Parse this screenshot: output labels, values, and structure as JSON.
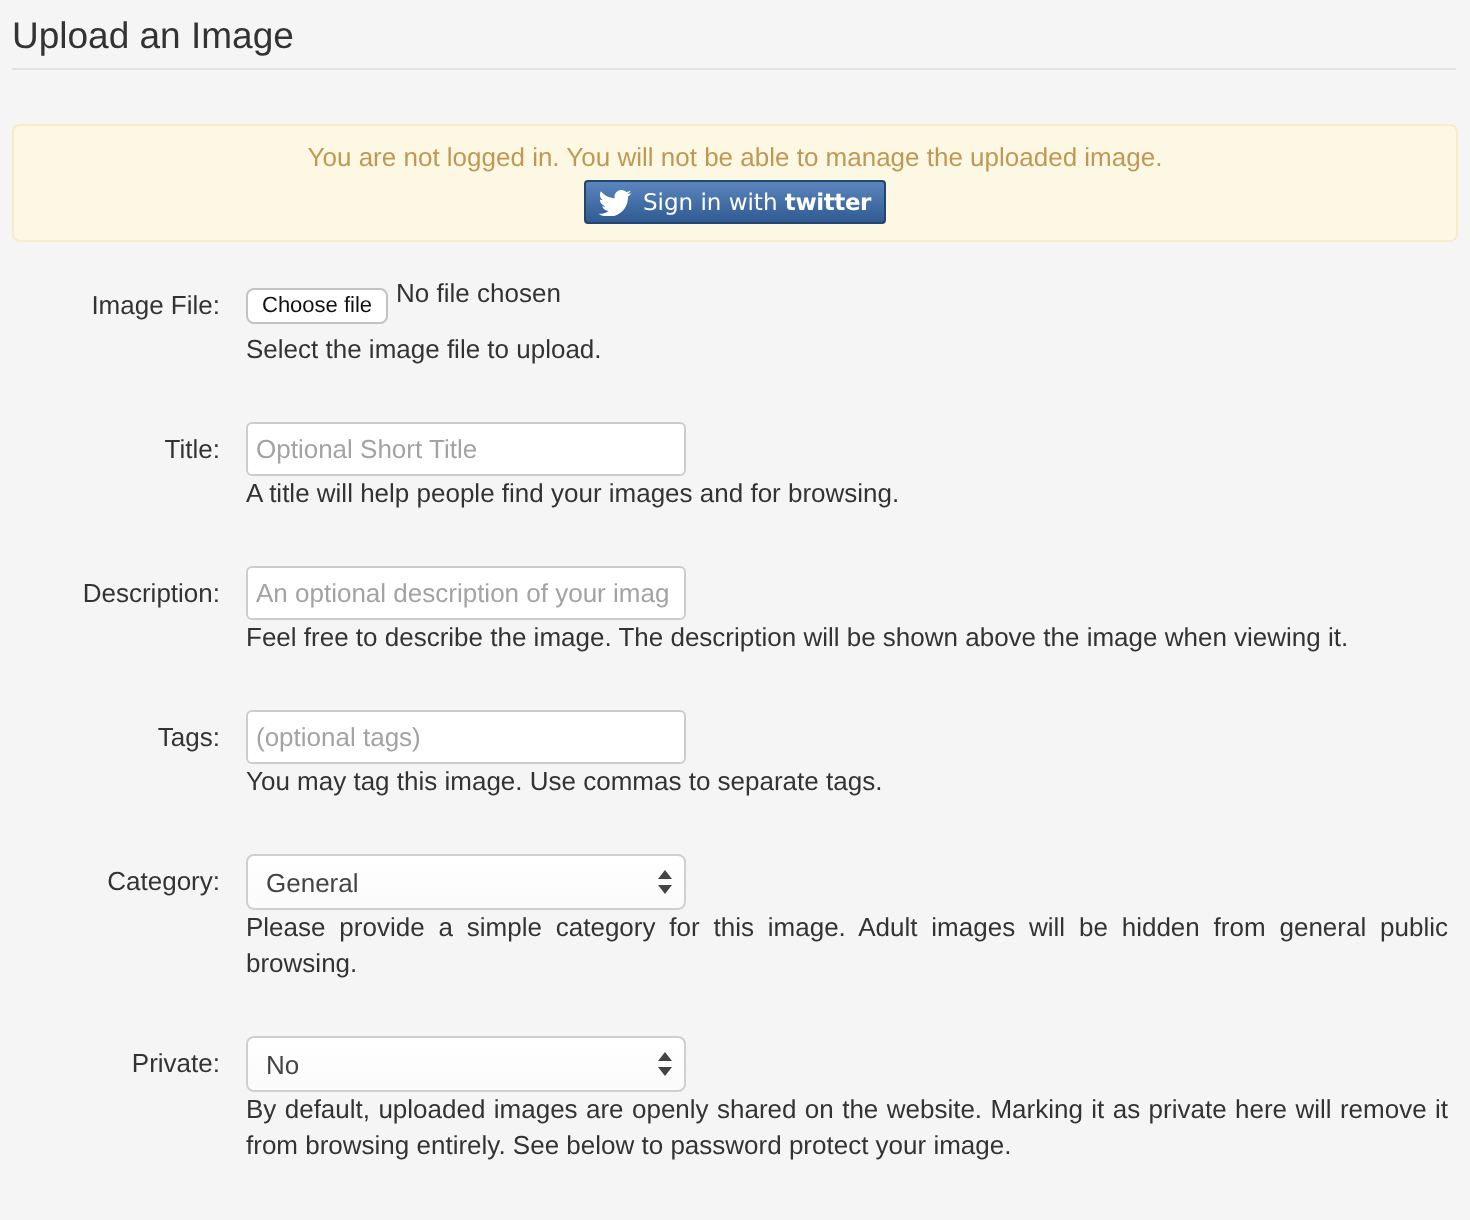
{
  "page_title": "Upload an Image",
  "alert": {
    "message": "You are not logged in. You will not be able to manage the uploaded image.",
    "button": {
      "label": "Sign in with",
      "brand": "twitter"
    }
  },
  "fields": [
    {
      "kind": "file",
      "label": "Image File:",
      "button": "Choose file",
      "status": "No file chosen",
      "help": "Select the image file to upload."
    },
    {
      "kind": "text",
      "label": "Title:",
      "placeholder": "Optional Short Title",
      "help": "A title will help people find your images and for browsing."
    },
    {
      "kind": "text",
      "label": "Description:",
      "placeholder": "An optional description of your imag",
      "help": "Feel free to describe the image. The description will be shown above the image when viewing it."
    },
    {
      "kind": "text",
      "label": "Tags:",
      "placeholder": "(optional tags)",
      "help": "You may tag this image. Use commas to separate tags."
    },
    {
      "kind": "select",
      "label": "Category:",
      "value": "General",
      "help": "Please provide a simple category for this image. Adult images will be hidden from general public browsing."
    },
    {
      "kind": "select",
      "label": "Private:",
      "value": "No",
      "help": "By default, uploaded images are openly shared on the website. Marking it as private here will remove it from browsing entirely. See below to password protect your image."
    }
  ]
}
